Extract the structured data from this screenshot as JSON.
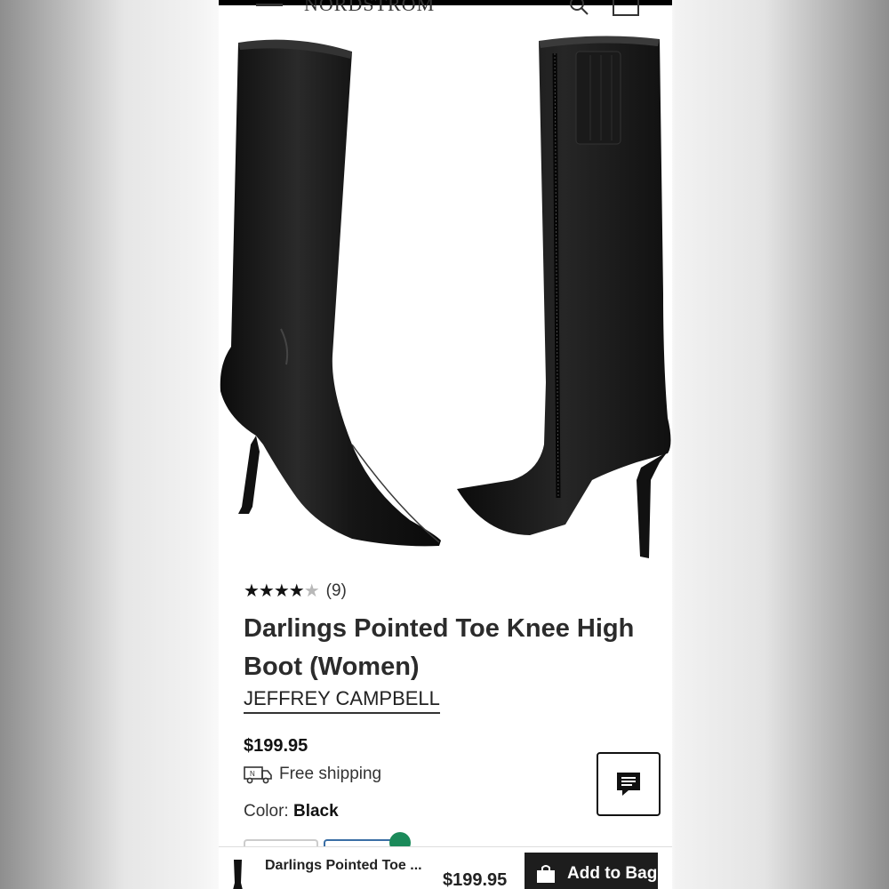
{
  "header": {
    "logo_text": "NORDSTROM"
  },
  "product": {
    "rating_stars": "★★★★",
    "rating_empty_star": "★",
    "review_count": "(9)",
    "title": "Darlings Pointed Toe Knee High Boot (Women)",
    "brand": "JEFFREY CAMPBELL",
    "price": "$199.95",
    "shipping": "Free shipping",
    "color_label": "Color:",
    "color_value": "Black"
  },
  "bottom_bar": {
    "title": "Darlings Pointed Toe ...",
    "price": "$199.95",
    "add_to_bag_label": "Add to Bag"
  },
  "colors": {
    "accent_dark": "#1d1d1d",
    "selected_check": "#1b8a5a"
  }
}
